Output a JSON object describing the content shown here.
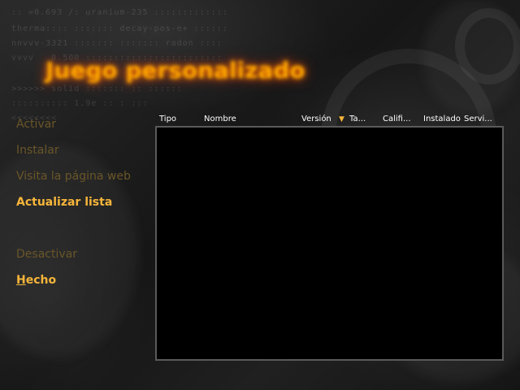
{
  "window": {
    "title": "Juego personalizado"
  },
  "menu": {
    "items": [
      {
        "label": "Activar",
        "state": "disabled"
      },
      {
        "label": "Instalar",
        "state": "disabled"
      },
      {
        "label": "Visita la página web",
        "state": "disabled"
      },
      {
        "label": "Actualizar lista",
        "state": "enabled"
      },
      {
        "label": "Desactivar",
        "state": "disabled"
      },
      {
        "label": "Hecho",
        "state": "enabled",
        "mnemonic": "H"
      }
    ]
  },
  "list": {
    "columns": [
      "Tipo",
      "Nombre",
      "Versión",
      "Ta...",
      "Califi...",
      "Instalado",
      "Servi..."
    ],
    "sort_column": "Versión",
    "sort_indicator": "▼",
    "rows": []
  },
  "colors": {
    "title": "#ffa800",
    "menu_enabled": "#f6b53a",
    "menu_disabled": "#6a5628",
    "list_background": "#000000",
    "list_border": "#5a5a5a"
  }
}
